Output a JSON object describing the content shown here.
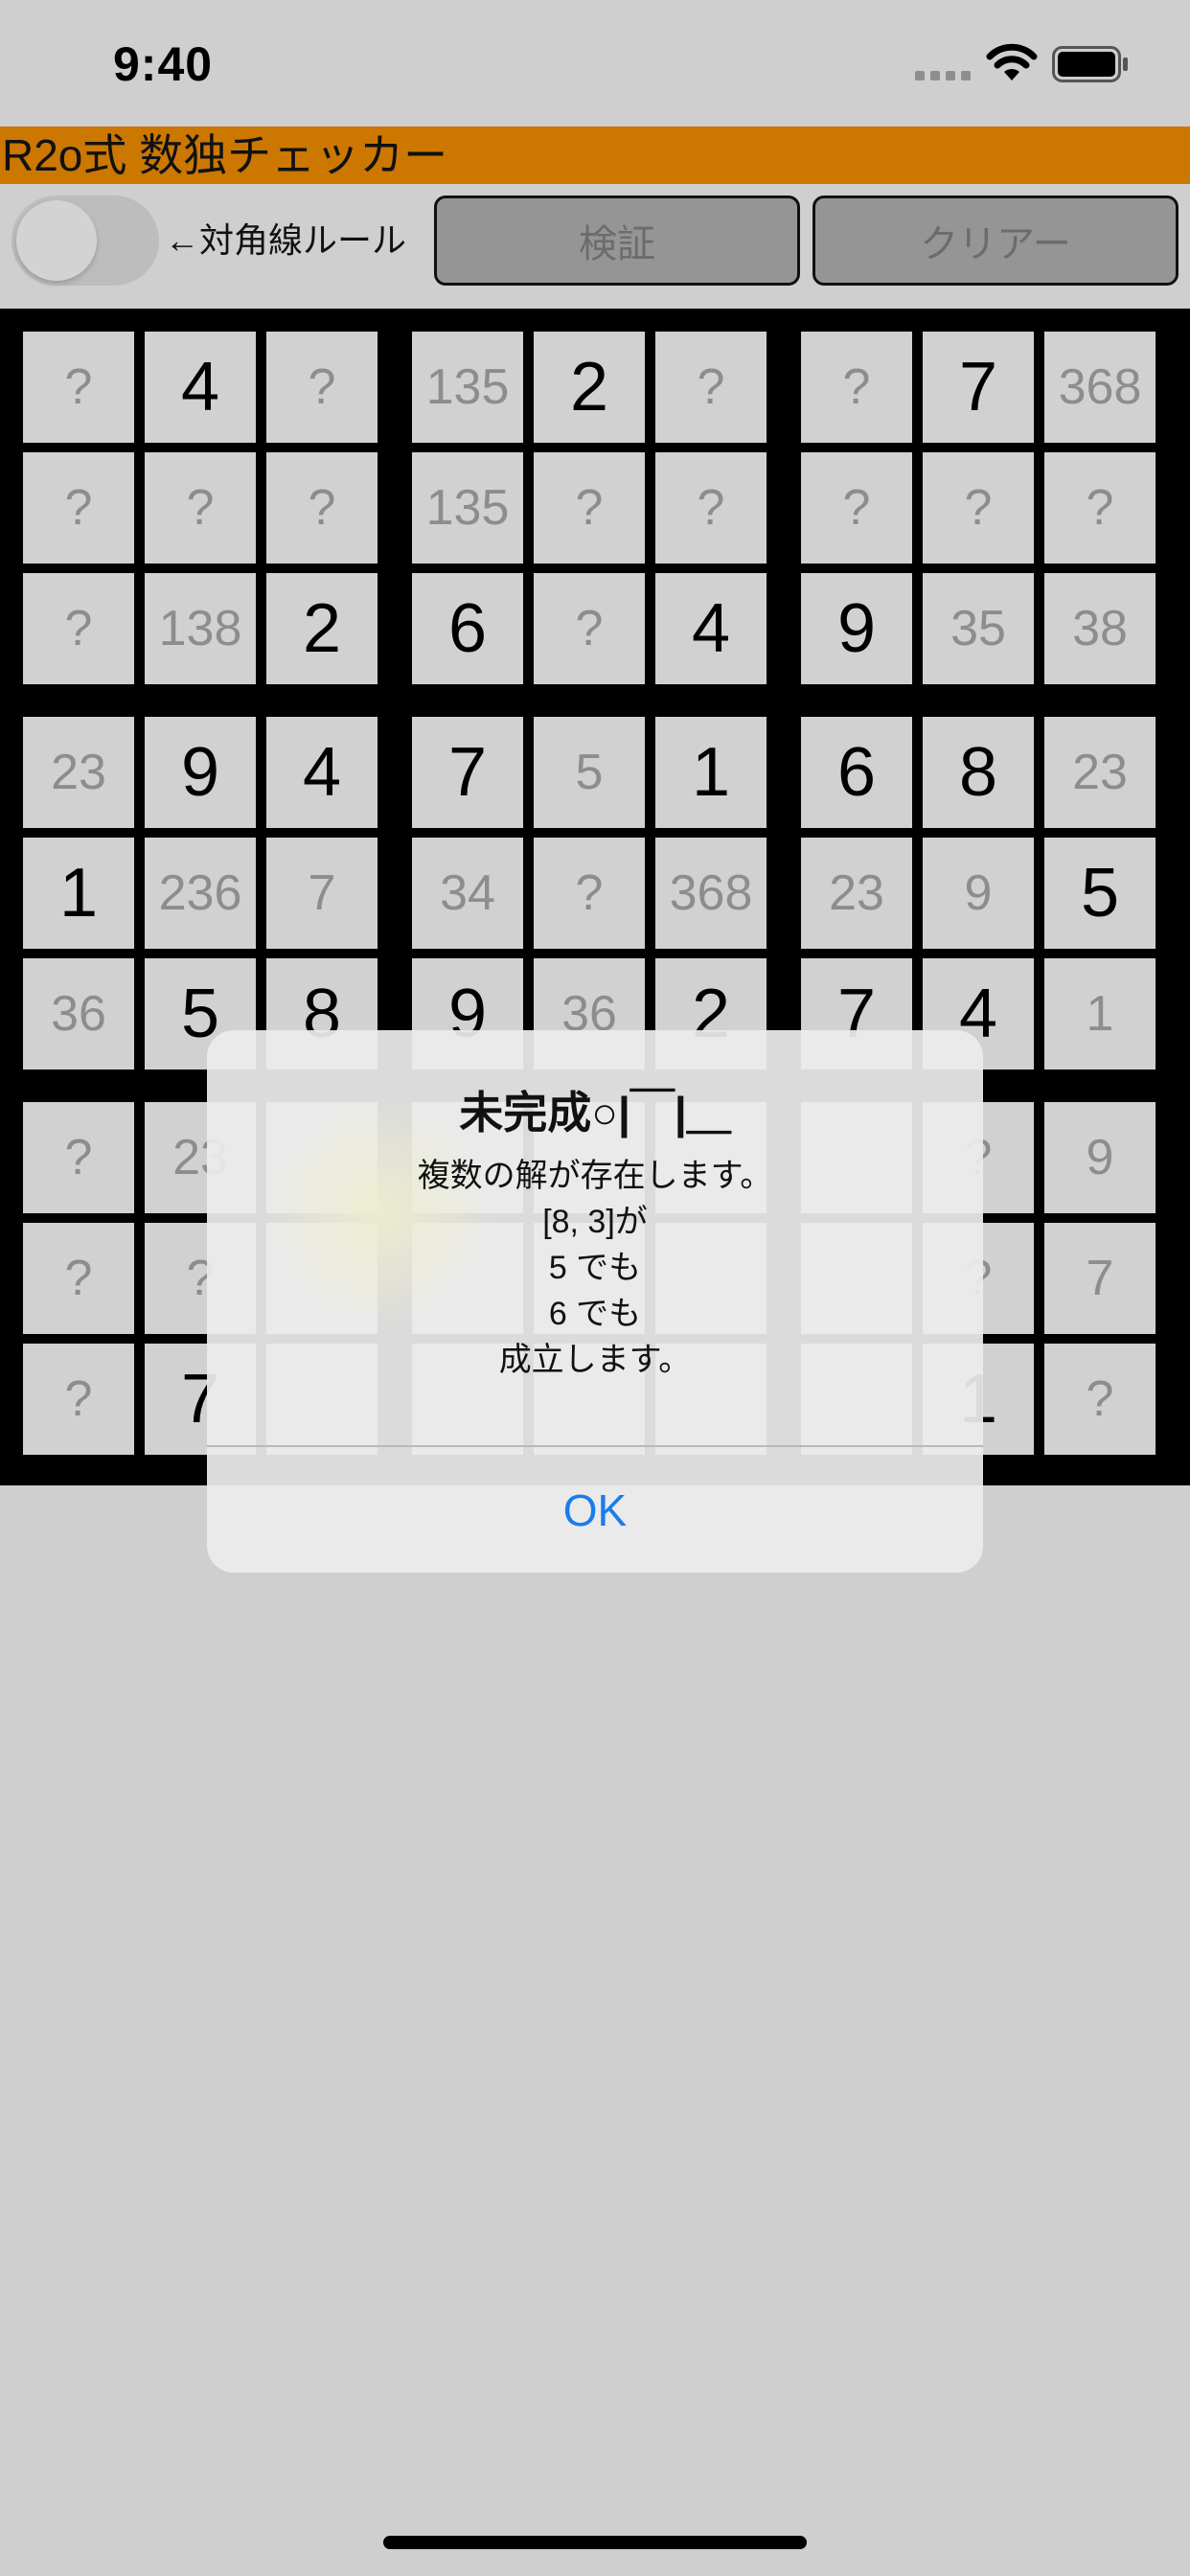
{
  "status_bar": {
    "time": "9:40",
    "icons": [
      "signal-icon",
      "wifi-icon",
      "battery-icon"
    ]
  },
  "app": {
    "title": "R2o式 数独チェッカー",
    "accent_color": "#cc7700"
  },
  "toolbar": {
    "diagonal_label": "←対角線ルール",
    "diagonal_toggle_on": false,
    "verify_label": "検証",
    "clear_label": "クリアー"
  },
  "board": {
    "rows": [
      [
        {
          "v": "?",
          "k": "cand"
        },
        {
          "v": "4",
          "k": "given"
        },
        {
          "v": "?",
          "k": "cand"
        },
        {
          "v": "135",
          "k": "cand"
        },
        {
          "v": "2",
          "k": "given"
        },
        {
          "v": "?",
          "k": "cand"
        },
        {
          "v": "?",
          "k": "cand"
        },
        {
          "v": "7",
          "k": "given"
        },
        {
          "v": "368",
          "k": "cand"
        }
      ],
      [
        {
          "v": "?",
          "k": "cand"
        },
        {
          "v": "?",
          "k": "cand"
        },
        {
          "v": "?",
          "k": "cand"
        },
        {
          "v": "135",
          "k": "cand"
        },
        {
          "v": "?",
          "k": "cand"
        },
        {
          "v": "?",
          "k": "cand"
        },
        {
          "v": "?",
          "k": "cand"
        },
        {
          "v": "?",
          "k": "cand"
        },
        {
          "v": "?",
          "k": "cand"
        }
      ],
      [
        {
          "v": "?",
          "k": "cand"
        },
        {
          "v": "138",
          "k": "cand"
        },
        {
          "v": "2",
          "k": "given"
        },
        {
          "v": "6",
          "k": "given"
        },
        {
          "v": "?",
          "k": "cand"
        },
        {
          "v": "4",
          "k": "given"
        },
        {
          "v": "9",
          "k": "given"
        },
        {
          "v": "35",
          "k": "cand"
        },
        {
          "v": "38",
          "k": "cand"
        }
      ],
      [
        {
          "v": "23",
          "k": "cand"
        },
        {
          "v": "9",
          "k": "given"
        },
        {
          "v": "4",
          "k": "given"
        },
        {
          "v": "7",
          "k": "given"
        },
        {
          "v": "5",
          "k": "cand"
        },
        {
          "v": "1",
          "k": "given"
        },
        {
          "v": "6",
          "k": "given"
        },
        {
          "v": "8",
          "k": "given"
        },
        {
          "v": "23",
          "k": "cand"
        }
      ],
      [
        {
          "v": "1",
          "k": "given"
        },
        {
          "v": "236",
          "k": "cand"
        },
        {
          "v": "7",
          "k": "cand"
        },
        {
          "v": "34",
          "k": "cand"
        },
        {
          "v": "?",
          "k": "cand"
        },
        {
          "v": "368",
          "k": "cand"
        },
        {
          "v": "23",
          "k": "cand"
        },
        {
          "v": "9",
          "k": "cand"
        },
        {
          "v": "5",
          "k": "given"
        }
      ],
      [
        {
          "v": "36",
          "k": "cand"
        },
        {
          "v": "5",
          "k": "given"
        },
        {
          "v": "8",
          "k": "given"
        },
        {
          "v": "9",
          "k": "given"
        },
        {
          "v": "36",
          "k": "cand"
        },
        {
          "v": "2",
          "k": "given"
        },
        {
          "v": "7",
          "k": "given"
        },
        {
          "v": "4",
          "k": "given"
        },
        {
          "v": "1",
          "k": "cand"
        }
      ],
      [
        {
          "v": "?",
          "k": "cand"
        },
        {
          "v": "23",
          "k": "cand"
        },
        {
          "v": "",
          "k": "cand"
        },
        {
          "v": "",
          "k": "cand"
        },
        {
          "v": "",
          "k": "cand"
        },
        {
          "v": "",
          "k": "cand"
        },
        {
          "v": "",
          "k": "cand"
        },
        {
          "v": "?",
          "k": "cand"
        },
        {
          "v": "9",
          "k": "cand"
        }
      ],
      [
        {
          "v": "?",
          "k": "cand"
        },
        {
          "v": "?",
          "k": "cand"
        },
        {
          "v": "",
          "k": "cand"
        },
        {
          "v": "",
          "k": "cand"
        },
        {
          "v": "",
          "k": "cand"
        },
        {
          "v": "",
          "k": "cand"
        },
        {
          "v": "",
          "k": "cand"
        },
        {
          "v": "?",
          "k": "cand"
        },
        {
          "v": "7",
          "k": "cand"
        }
      ],
      [
        {
          "v": "?",
          "k": "cand"
        },
        {
          "v": "7",
          "k": "given"
        },
        {
          "v": "",
          "k": "cand"
        },
        {
          "v": "",
          "k": "cand"
        },
        {
          "v": "",
          "k": "cand"
        },
        {
          "v": "",
          "k": "cand"
        },
        {
          "v": "",
          "k": "cand"
        },
        {
          "v": "1",
          "k": "given"
        },
        {
          "v": "?",
          "k": "cand"
        }
      ]
    ]
  },
  "alert": {
    "title": "未完成○|￣|＿",
    "lines": [
      "複数の解が存在します。",
      "[8, 3]が",
      "5 でも",
      "6 でも",
      "成立します。"
    ],
    "ok_label": "OK",
    "ok_color": "#1a7bef"
  }
}
